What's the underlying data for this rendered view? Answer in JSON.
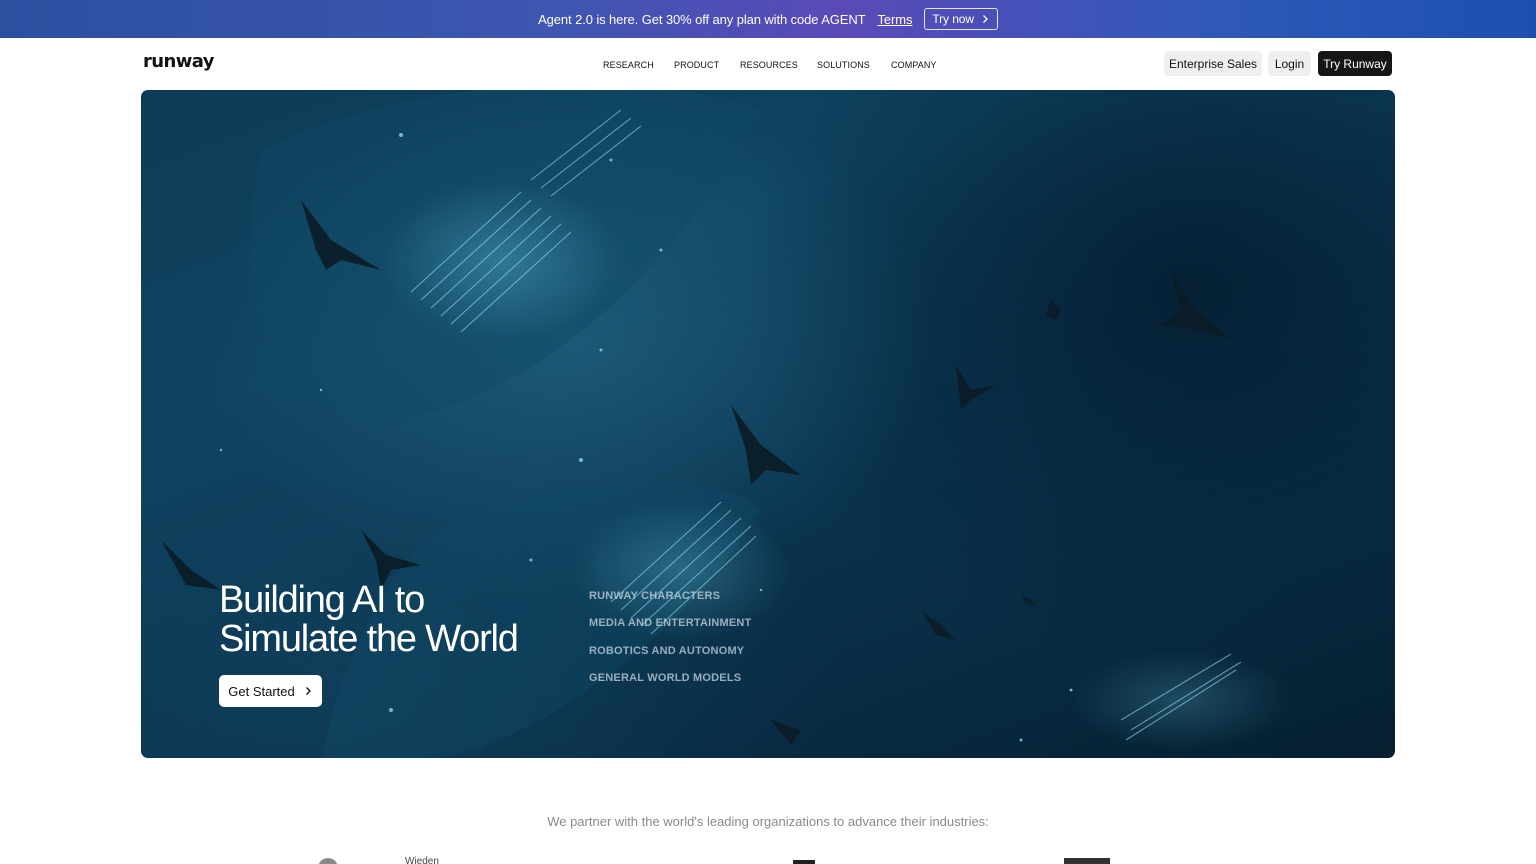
{
  "promo": {
    "text": "Agent 2.0 is here. Get 30% off any plan with code AGENT",
    "terms": "Terms",
    "try_label": "Try now"
  },
  "nav": {
    "logo": "runway",
    "links": [
      "RESEARCH",
      "PRODUCT",
      "RESOURCES",
      "SOLUTIONS",
      "COMPANY"
    ],
    "enterprise_label": "Enterprise Sales",
    "login_label": "Login",
    "try_label": "Try Runway"
  },
  "hero": {
    "title_line1": "Building AI to",
    "title_line2": "Simulate the World",
    "cta_label": "Get Started",
    "categories": [
      "RUNWAY CHARACTERS",
      "MEDIA AND ENTERTAINMENT",
      "ROBOTICS AND AUTONOMY",
      "GENERAL WORLD MODELS"
    ]
  },
  "partners": {
    "text": "We partner with the world's leading organizations to advance their industries:",
    "logo_fragment": "Wieden"
  },
  "colors": {
    "promo_gradient": [
      "#2c4fa0",
      "#5a4ab8",
      "#1c4fb0"
    ],
    "hero_bg": "#0a3550",
    "dark_button": "#161616",
    "light_button": "#efefef"
  },
  "icons": {
    "promo_try": "chevron-right-icon",
    "hero_cta": "chevron-right-icon"
  }
}
